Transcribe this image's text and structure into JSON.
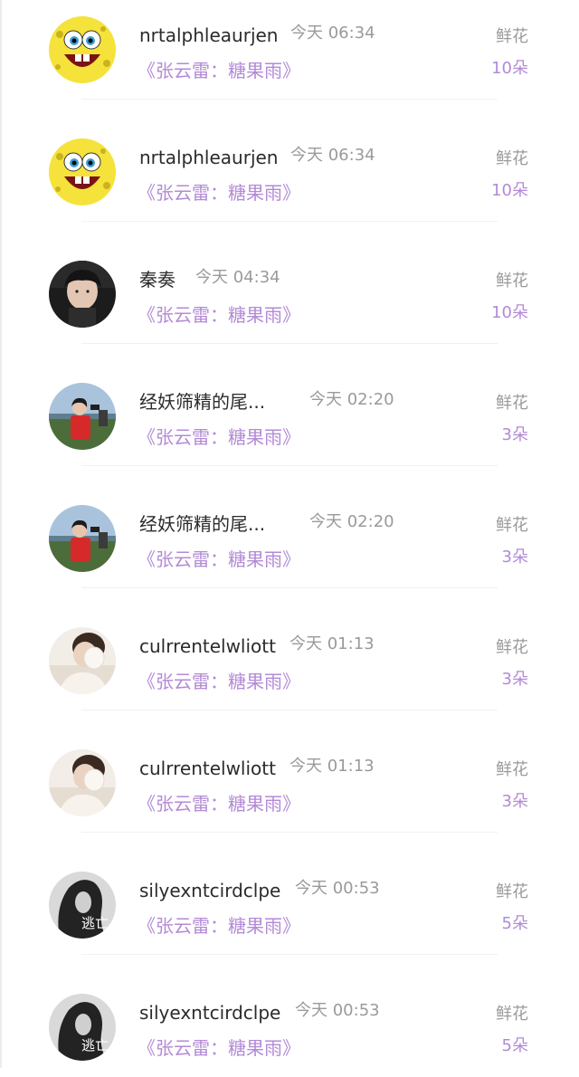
{
  "rows": [
    {
      "user": "nrtalphleaurjen",
      "time": "今天 06:34",
      "song": "《张云雷：糖果雨》",
      "gift": "鲜花",
      "count": "10朵",
      "avatar": "spongebob-avatar"
    },
    {
      "user": "nrtalphleaurjen",
      "time": "今天 06:34",
      "song": "《张云雷：糖果雨》",
      "gift": "鲜花",
      "count": "10朵",
      "avatar": "spongebob-avatar"
    },
    {
      "user": "秦奏",
      "time": "今天 04:34",
      "song": "《张云雷：糖果雨》",
      "gift": "鲜花",
      "count": "10朵",
      "avatar": "portrait-dark-avatar"
    },
    {
      "user": "经妖筛精的尾...",
      "time": "今天 02:20",
      "song": "《张云雷：糖果雨》",
      "gift": "鲜花",
      "count": "3朵",
      "avatar": "red-shirt-avatar"
    },
    {
      "user": "经妖筛精的尾...",
      "time": "今天 02:20",
      "song": "《张云雷：糖果雨》",
      "gift": "鲜花",
      "count": "3朵",
      "avatar": "red-shirt-avatar"
    },
    {
      "user": "culrrentelwliott",
      "time": "今天 01:13",
      "song": "《张云雷：糖果雨》",
      "gift": "鲜花",
      "count": "3朵",
      "avatar": "earmuff-avatar"
    },
    {
      "user": "culrrentelwliott",
      "time": "今天 01:13",
      "song": "《张云雷：糖果雨》",
      "gift": "鲜花",
      "count": "3朵",
      "avatar": "earmuff-avatar"
    },
    {
      "user": "silyexntcirdclpe",
      "time": "今天 00:53",
      "song": "《张云雷：糖果雨》",
      "gift": "鲜花",
      "count": "5朵",
      "avatar": "bw-hair-avatar"
    },
    {
      "user": "silyexntcirdclpe",
      "time": "今天 00:53",
      "song": "《张云雷：糖果雨》",
      "gift": "鲜花",
      "count": "5朵",
      "avatar": "bw-hair-avatar"
    }
  ],
  "avatar_glyph": "逃亡",
  "colors": {
    "accent": "#b38ad6",
    "name": "#2b2b2b",
    "muted": "#9a9a9a"
  }
}
